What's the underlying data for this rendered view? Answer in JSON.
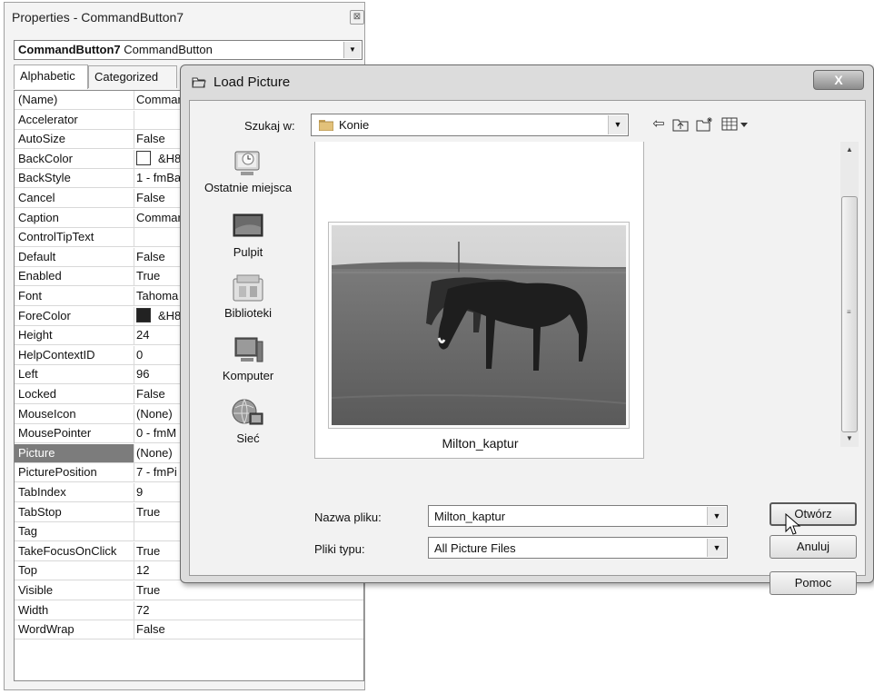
{
  "properties_window": {
    "title": "Properties - CommandButton7",
    "close_glyph": "⊠",
    "object_selector": {
      "name": "CommandButton7",
      "type": "CommandButton"
    },
    "tabs": [
      "Alphabetic",
      "Categorized"
    ],
    "active_tab": "Alphabetic",
    "rows": [
      {
        "name": "(Name)",
        "value": "Commar"
      },
      {
        "name": "Accelerator",
        "value": ""
      },
      {
        "name": "AutoSize",
        "value": "False"
      },
      {
        "name": "BackColor",
        "value": "&H8(",
        "swatch": "#ffffff"
      },
      {
        "name": "BackStyle",
        "value": "1 - fmBa"
      },
      {
        "name": "Cancel",
        "value": "False"
      },
      {
        "name": "Caption",
        "value": "Commar"
      },
      {
        "name": "ControlTipText",
        "value": ""
      },
      {
        "name": "Default",
        "value": "False"
      },
      {
        "name": "Enabled",
        "value": "True"
      },
      {
        "name": "Font",
        "value": "Tahoma"
      },
      {
        "name": "ForeColor",
        "value": "&H8(",
        "swatch": "#222222"
      },
      {
        "name": "Height",
        "value": "24"
      },
      {
        "name": "HelpContextID",
        "value": "0"
      },
      {
        "name": "Left",
        "value": "96"
      },
      {
        "name": "Locked",
        "value": "False"
      },
      {
        "name": "MouseIcon",
        "value": "(None)"
      },
      {
        "name": "MousePointer",
        "value": "0 - fmM"
      },
      {
        "name": "Picture",
        "value": "(None)",
        "selected": true
      },
      {
        "name": "PicturePosition",
        "value": "7 - fmPi"
      },
      {
        "name": "TabIndex",
        "value": "9"
      },
      {
        "name": "TabStop",
        "value": "True"
      },
      {
        "name": "Tag",
        "value": ""
      },
      {
        "name": "TakeFocusOnClick",
        "value": "True"
      },
      {
        "name": "Top",
        "value": "12"
      },
      {
        "name": "Visible",
        "value": "True"
      },
      {
        "name": "Width",
        "value": "72"
      },
      {
        "name": "WordWrap",
        "value": "False"
      }
    ]
  },
  "dialog": {
    "title": "Load Picture",
    "close_label": "X",
    "look_in_label": "Szukaj w:",
    "look_in_value": "Konie",
    "toolbar_icons": [
      "back-icon",
      "up-folder-icon",
      "new-folder-icon",
      "views-menu-icon"
    ],
    "places": [
      {
        "label": "Ostatnie miejsca",
        "icon": "recent-places-icon"
      },
      {
        "label": "Pulpit",
        "icon": "desktop-icon"
      },
      {
        "label": "Biblioteki",
        "icon": "libraries-icon"
      },
      {
        "label": "Komputer",
        "icon": "computer-icon"
      },
      {
        "label": "Sieć",
        "icon": "network-icon"
      }
    ],
    "file": {
      "name": "Milton_kaptur"
    },
    "filename_label": "Nazwa pliku:",
    "filename_value": "Milton_kaptur",
    "filetype_label": "Pliki typu:",
    "filetype_value": "All Picture Files",
    "buttons": {
      "open": "Otwórz",
      "cancel": "Anuluj",
      "help": "Pomoc"
    }
  }
}
